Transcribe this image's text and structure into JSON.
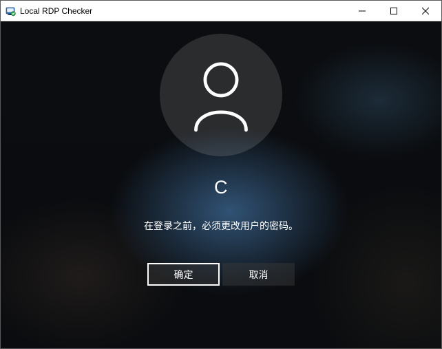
{
  "window": {
    "title": "Local RDP Checker"
  },
  "login": {
    "username": "C",
    "message": "在登录之前，必须更改用户的密码。",
    "ok_label": "确定",
    "cancel_label": "取消"
  }
}
